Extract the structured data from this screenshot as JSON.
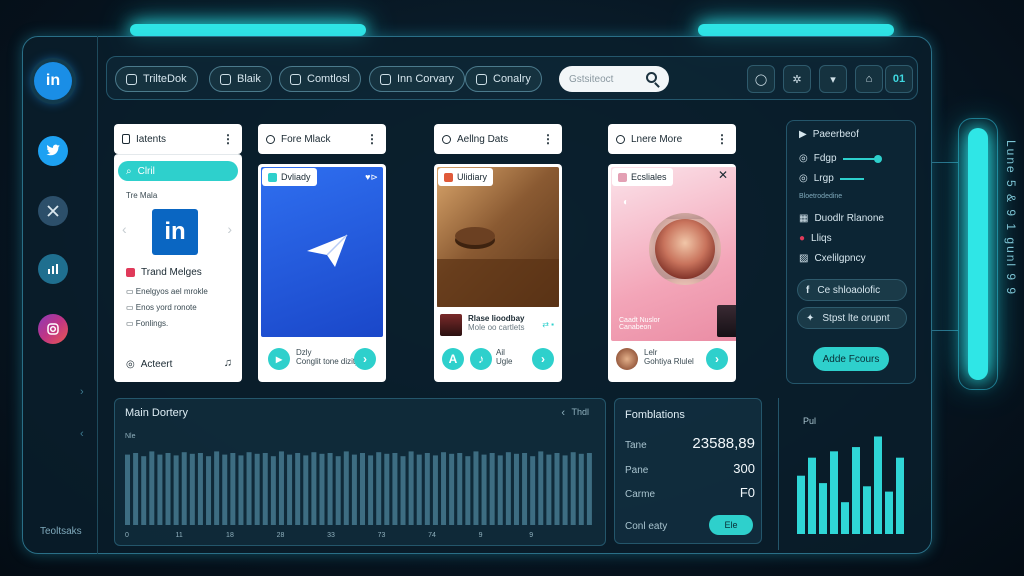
{
  "nav": {
    "items": [
      {
        "label": "TrilteDok"
      },
      {
        "label": "Blaik"
      },
      {
        "label": "Comtlosl"
      },
      {
        "label": "Inn Corvary"
      },
      {
        "label": "Conalry"
      }
    ],
    "search_placeholder": "Gstsiteoct",
    "right_badge": "01"
  },
  "sidebar": {
    "icons": [
      "linkedin-icon",
      "twitter-icon",
      "x-icon",
      "chart-icon",
      "instagram-icon"
    ],
    "linkedin_text": "in",
    "footer": "Teoltsaks"
  },
  "cards": [
    {
      "title": "Iatents",
      "pill": "Clril",
      "subtitle": "Tre Mala",
      "logo_text": "in",
      "row_title": "Trand Melges",
      "lines": [
        "Enelgyos ael mrokle",
        "Enos yord ronote",
        "Fonlings."
      ],
      "footer_label": "Acteert"
    },
    {
      "title": "Fore Mlack",
      "tag": "Dvliady",
      "foot_a": "Dzly",
      "foot_b": "Conglit tone dizity"
    },
    {
      "title": "Aellng Dats",
      "tag": "Ulidiary",
      "caption_title": "Rlase lioodbay",
      "caption_sub": "Mole oo cartlets",
      "foot_a": "Ail",
      "foot_b": "Ugle"
    },
    {
      "title": "Lnere More",
      "tag": "Ecsliales",
      "caption": "Caadt Nuslor",
      "caption_sub": "Canabeon",
      "foot_a": "Lelr",
      "foot_b": "Gohtiya Rlulel"
    }
  ],
  "right_panel": {
    "title": "Paeerbeof",
    "slider1": "Fdgp",
    "slider2": "Lrgp",
    "section_label": "Bloetrodedine",
    "items": [
      "Duodlr Rlanone",
      "Lliqs",
      "Cxelilgpncy"
    ],
    "social": [
      {
        "icon": "facebook-icon",
        "label": "Ce shloaolofic"
      },
      {
        "icon": "twitter-icon",
        "label": "Stpst lte orupnt"
      }
    ],
    "add_button": "Adde Fcours"
  },
  "gallery": {
    "title": "Main Dortery",
    "small_label": "Nle",
    "right_label": "Thdl",
    "x_ticks": [
      "0",
      "11",
      "18",
      "28",
      "33",
      "73",
      "74",
      "9",
      "9"
    ],
    "bars": [
      0.88,
      0.9,
      0.86,
      0.92,
      0.88,
      0.9,
      0.87,
      0.91,
      0.89,
      0.9,
      0.86,
      0.92,
      0.88,
      0.9,
      0.87,
      0.91,
      0.89,
      0.9,
      0.86,
      0.92,
      0.88,
      0.9,
      0.87,
      0.91,
      0.89,
      0.9,
      0.86,
      0.92,
      0.88,
      0.9,
      0.87,
      0.91,
      0.89,
      0.9,
      0.86,
      0.92,
      0.88,
      0.9,
      0.87,
      0.91,
      0.89,
      0.9,
      0.86,
      0.92,
      0.88,
      0.9,
      0.87,
      0.91,
      0.89,
      0.9,
      0.86,
      0.92,
      0.88,
      0.9,
      0.87,
      0.91,
      0.89,
      0.9
    ]
  },
  "stats": {
    "title": "Fomblations",
    "rows": [
      {
        "label": "Tane",
        "value": "23588,89"
      },
      {
        "label": "Pane",
        "value": "300"
      },
      {
        "label": "Carme",
        "value": "F0"
      }
    ],
    "footer_label": "Conl eaty",
    "footer_btn": "Ele"
  },
  "minichart": {
    "label": "Pul",
    "bars": [
      0.55,
      0.72,
      0.48,
      0.78,
      0.3,
      0.82,
      0.45,
      0.92,
      0.4,
      0.72
    ]
  },
  "side_text": "Lune 5 & 9 1 gunl 9 9"
}
